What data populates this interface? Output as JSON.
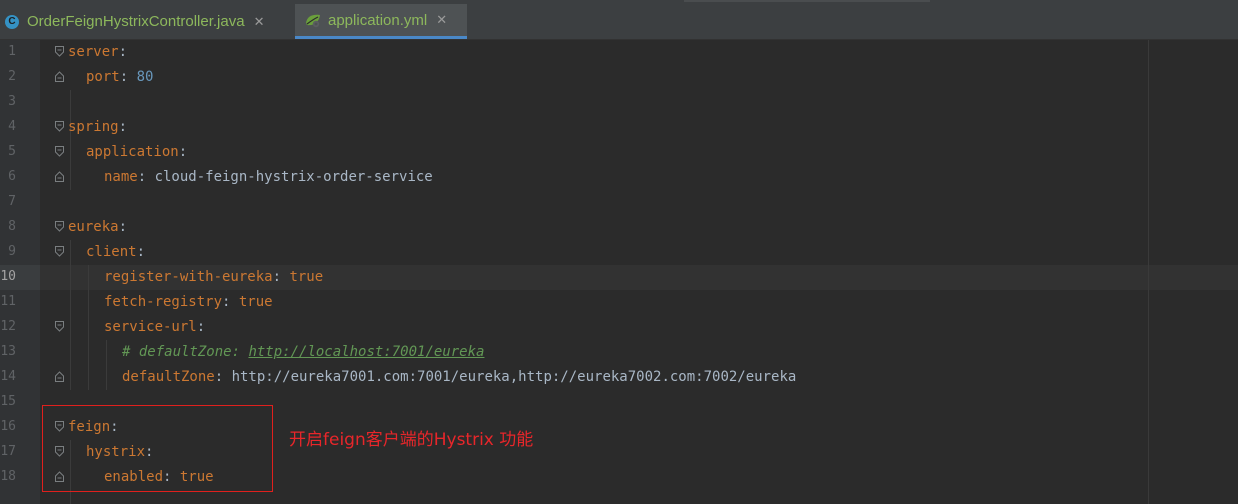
{
  "tabs": [
    {
      "icon": "java-class-icon",
      "label": "OrderFeignHystrixController.java",
      "close": "✕",
      "active": false
    },
    {
      "icon": "yml-spring-icon",
      "label": "application.yml",
      "close": "✕",
      "active": true
    }
  ],
  "editor": {
    "current_line": 10,
    "lines": [
      {
        "n": "1",
        "key": "server",
        "sep": ":",
        "val": ""
      },
      {
        "n": "2",
        "key": "port",
        "sep": ": ",
        "val": "80"
      },
      {
        "n": "3",
        "key": "",
        "sep": "",
        "val": ""
      },
      {
        "n": "4",
        "key": "spring",
        "sep": ":",
        "val": ""
      },
      {
        "n": "5",
        "key": "application",
        "sep": ":",
        "val": ""
      },
      {
        "n": "6",
        "key": "name",
        "sep": ": ",
        "val": "cloud-feign-hystrix-order-service"
      },
      {
        "n": "7",
        "key": "",
        "sep": "",
        "val": ""
      },
      {
        "n": "8",
        "key": "eureka",
        "sep": ":",
        "val": ""
      },
      {
        "n": "9",
        "key": "client",
        "sep": ":",
        "val": ""
      },
      {
        "n": "10",
        "key": "register-with-eureka",
        "sep": ": ",
        "val": "true"
      },
      {
        "n": "11",
        "key": "fetch-registry",
        "sep": ": ",
        "val": "true"
      },
      {
        "n": "12",
        "key": "service-url",
        "sep": ":",
        "val": ""
      },
      {
        "n": "13",
        "comment_prefix": "# defaultZone: ",
        "comment_link": "http://localhost:7001/eureka"
      },
      {
        "n": "14",
        "key": "defaultZone",
        "sep": ": ",
        "val": "http://eureka7001.com:7001/eureka,http://eureka7002.com:7002/eureka"
      },
      {
        "n": "15",
        "key": "",
        "sep": "",
        "val": ""
      },
      {
        "n": "16",
        "key": "feign",
        "sep": ":",
        "val": ""
      },
      {
        "n": "17",
        "key": "hystrix",
        "sep": ":",
        "val": ""
      },
      {
        "n": "18",
        "key": "enabled",
        "sep": ": ",
        "val": "true"
      }
    ]
  },
  "annotation": {
    "text": "开启feign客户端的Hystrix 功能",
    "color": "#e8262a"
  },
  "colors": {
    "background": "#2b2b2b",
    "key": "#cc7832",
    "number": "#6897bb",
    "comment": "#629755",
    "tab_text": "#8db85c"
  }
}
